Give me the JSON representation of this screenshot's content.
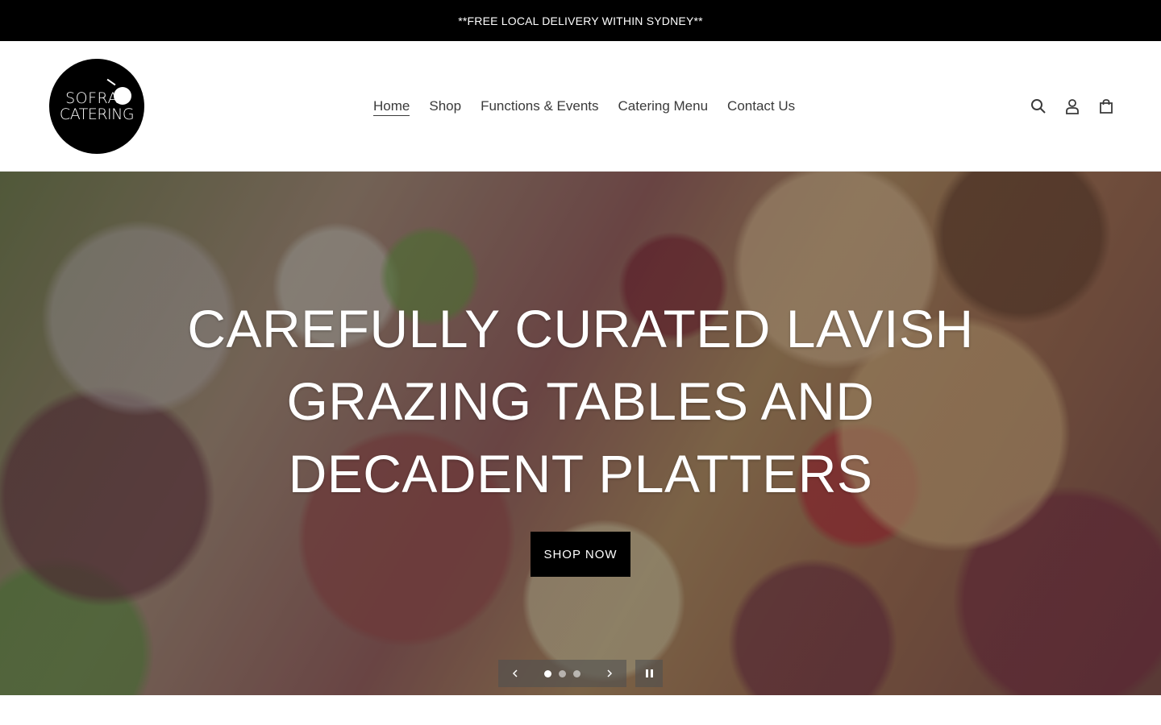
{
  "announcement": {
    "text": "**FREE LOCAL DELIVERY WITHIN SYDNEY**"
  },
  "header": {
    "logo": {
      "line1": "SOFRA",
      "line2": "CATERING"
    },
    "nav": [
      {
        "label": "Home",
        "active": true
      },
      {
        "label": "Shop"
      },
      {
        "label": "Functions & Events"
      },
      {
        "label": "Catering Menu"
      },
      {
        "label": "Contact Us"
      }
    ],
    "icons": [
      "search-icon",
      "account-icon",
      "cart-icon"
    ]
  },
  "hero": {
    "title": "CAREFULLY CURATED LAVISH GRAZING TABLES AND DECADENT PLATTERS",
    "button_label": "SHOP NOW",
    "slides": {
      "count": 3,
      "active": 1
    }
  },
  "colors": {
    "announcement_bg": "#000000",
    "button_bg": "#000000",
    "text": "#3a3a3a",
    "white": "#ffffff"
  }
}
